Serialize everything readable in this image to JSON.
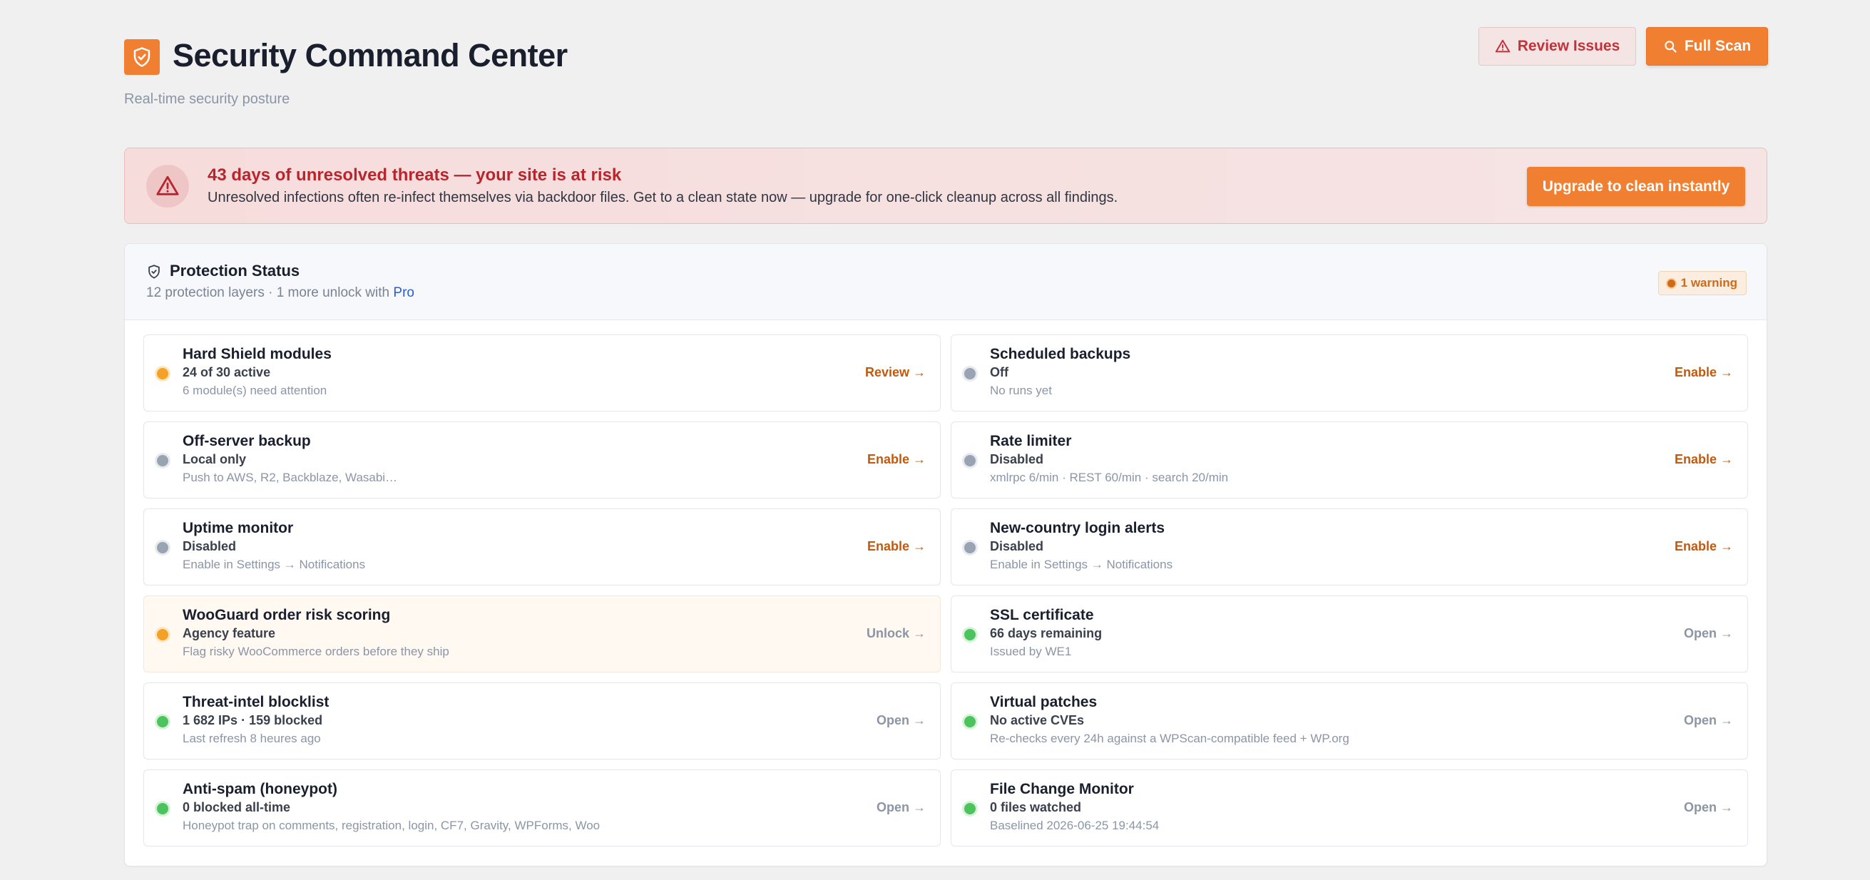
{
  "header": {
    "title": "Security Command Center",
    "subtitle": "Real-time security posture",
    "review_label": "Review Issues",
    "scan_label": "Full Scan"
  },
  "alert": {
    "title": "43 days of unresolved threats — your site is at risk",
    "text": "Unresolved infections often re-infect themselves via backdoor files. Get to a clean state now — upgrade for one-click cleanup across all findings.",
    "button_label": "Upgrade to clean instantly"
  },
  "panel": {
    "title": "Protection Status",
    "subtitle_prefix": "12 protection layers · 1 more unlock with ",
    "subtitle_link": "Pro",
    "badge": "1 warning"
  },
  "colors": {
    "accent": "#f07f32",
    "danger": "#b8262d",
    "status_warning": "#f4a227",
    "status_off": "#9aa3b2",
    "status_ok": "#4cc35c"
  },
  "cards": [
    {
      "title": "Hard Shield modules",
      "status": "24 of 30 active",
      "detail": "6 module(s) need attention",
      "action": "Review →",
      "state": "orange",
      "action_style": "active"
    },
    {
      "title": "Scheduled backups",
      "status": "Off",
      "detail": "No runs yet",
      "action": "Enable →",
      "state": "gray",
      "action_style": "active"
    },
    {
      "title": "Off-server backup",
      "status": "Local only",
      "detail": "Push to AWS, R2, Backblaze, Wasabi…",
      "action": "Enable →",
      "state": "gray",
      "action_style": "active"
    },
    {
      "title": "Rate limiter",
      "status": "Disabled",
      "detail": "xmlrpc 6/min · REST 60/min · search 20/min",
      "action": "Enable →",
      "state": "gray",
      "action_style": "active"
    },
    {
      "title": "Uptime monitor",
      "status": "Disabled",
      "detail": "Enable in Settings → Notifications",
      "action": "Enable →",
      "state": "gray",
      "action_style": "active"
    },
    {
      "title": "New-country login alerts",
      "status": "Disabled",
      "detail": "Enable in Settings → Notifications",
      "action": "Enable →",
      "state": "gray",
      "action_style": "active"
    },
    {
      "title": "WooGuard order risk scoring",
      "status": "Agency feature",
      "detail": "Flag risky WooCommerce orders before they ship",
      "action": "Unlock →",
      "state": "orange",
      "action_style": "muted",
      "highlight": true
    },
    {
      "title": "SSL certificate",
      "status": "66 days remaining",
      "detail": "Issued by WE1",
      "action": "Open →",
      "state": "green",
      "action_style": "muted"
    },
    {
      "title": "Threat-intel blocklist",
      "status": "1 682 IPs · 159 blocked",
      "detail": "Last refresh 8 heures ago",
      "action": "Open →",
      "state": "green",
      "action_style": "muted"
    },
    {
      "title": "Virtual patches",
      "status": "No active CVEs",
      "detail": "Re-checks every 24h against a WPScan-compatible feed + WP.org",
      "action": "Open →",
      "state": "green",
      "action_style": "muted"
    },
    {
      "title": "Anti-spam (honeypot)",
      "status": "0 blocked all-time",
      "detail": "Honeypot trap on comments, registration, login, CF7, Gravity, WPForms, Woo",
      "action": "Open →",
      "state": "green",
      "action_style": "muted"
    },
    {
      "title": "File Change Monitor",
      "status": "0 files watched",
      "detail": "Baselined 2026-06-25 19:44:54",
      "action": "Open →",
      "state": "green",
      "action_style": "muted"
    }
  ]
}
